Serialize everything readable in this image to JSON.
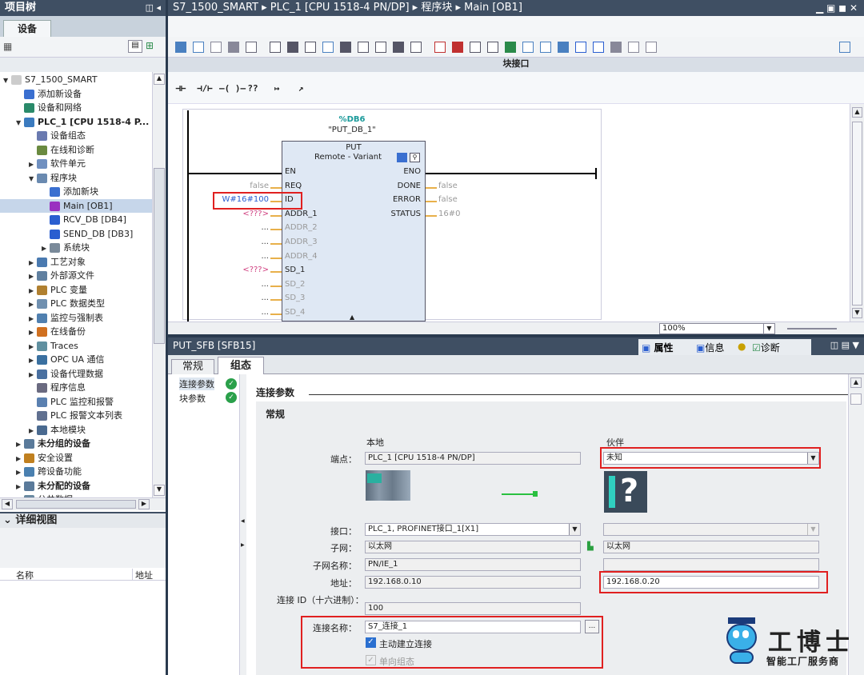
{
  "left_header": {
    "title": "项目树"
  },
  "left_tab": "设备",
  "tree": [
    {
      "label": "S7_1500_SMART",
      "indent": 0,
      "tw": "▼",
      "icon": "project-icon",
      "color": "#ccc"
    },
    {
      "label": "添加新设备",
      "indent": 1,
      "tw": "",
      "icon": "add-device-icon",
      "color": "#3a6fd0"
    },
    {
      "label": "设备和网络",
      "indent": 1,
      "tw": "",
      "icon": "network-icon",
      "color": "#2a8a6a"
    },
    {
      "label": "PLC_1 [CPU 1518-4 P...",
      "indent": 1,
      "tw": "▼",
      "icon": "plc-icon",
      "color": "#3b7bbf",
      "bold": true
    },
    {
      "label": "设备组态",
      "indent": 2,
      "tw": "",
      "icon": "device-config-icon",
      "color": "#6a7ab0"
    },
    {
      "label": "在线和诊断",
      "indent": 2,
      "tw": "",
      "icon": "online-diagnostics-icon",
      "color": "#6a8a40"
    },
    {
      "label": "软件单元",
      "indent": 2,
      "tw": "▶",
      "icon": "software-unit-icon",
      "color": "#7090c0"
    },
    {
      "label": "程序块",
      "indent": 2,
      "tw": "▼",
      "icon": "program-blocks-icon",
      "color": "#6a8ab0"
    },
    {
      "label": "添加新块",
      "indent": 3,
      "tw": "",
      "icon": "add-block-icon",
      "color": "#3a6fd0"
    },
    {
      "label": "Main [OB1]",
      "indent": 3,
      "tw": "",
      "icon": "ob-icon",
      "color": "#9a30c0",
      "selected": true
    },
    {
      "label": "RCV_DB [DB4]",
      "indent": 3,
      "tw": "",
      "icon": "db-icon",
      "color": "#2a5ed0"
    },
    {
      "label": "SEND_DB [DB3]",
      "indent": 3,
      "tw": "",
      "icon": "db-icon",
      "color": "#2a5ed0"
    },
    {
      "label": "系统块",
      "indent": 3,
      "tw": "▶",
      "icon": "system-blocks-icon",
      "color": "#7a8a9a"
    },
    {
      "label": "工艺对象",
      "indent": 2,
      "tw": "▶",
      "icon": "technology-objects-icon",
      "color": "#4a7ab0"
    },
    {
      "label": "外部源文件",
      "indent": 2,
      "tw": "▶",
      "icon": "external-source-icon",
      "color": "#6080a0"
    },
    {
      "label": "PLC 变量",
      "indent": 2,
      "tw": "▶",
      "icon": "plc-tags-icon",
      "color": "#b08030"
    },
    {
      "label": "PLC 数据类型",
      "indent": 2,
      "tw": "▶",
      "icon": "plc-datatype-icon",
      "color": "#7090b0"
    },
    {
      "label": "监控与强制表",
      "indent": 2,
      "tw": "▶",
      "icon": "watch-table-icon",
      "color": "#5080b0"
    },
    {
      "label": "在线备份",
      "indent": 2,
      "tw": "▶",
      "icon": "online-backup-icon",
      "color": "#d07020"
    },
    {
      "label": "Traces",
      "indent": 2,
      "tw": "▶",
      "icon": "traces-icon",
      "color": "#6090a0"
    },
    {
      "label": "OPC UA 通信",
      "indent": 2,
      "tw": "▶",
      "icon": "opcua-icon",
      "color": "#3a70a0"
    },
    {
      "label": "设备代理数据",
      "indent": 2,
      "tw": "▶",
      "icon": "device-proxy-icon",
      "color": "#4a70a0"
    },
    {
      "label": "程序信息",
      "indent": 2,
      "tw": "",
      "icon": "program-info-icon",
      "color": "#6a6a80"
    },
    {
      "label": "PLC 监控和报警",
      "indent": 2,
      "tw": "",
      "icon": "plc-alarms-icon",
      "color": "#5a80b0"
    },
    {
      "label": "PLC 报警文本列表",
      "indent": 2,
      "tw": "",
      "icon": "alarm-text-icon",
      "color": "#607090"
    },
    {
      "label": "本地模块",
      "indent": 2,
      "tw": "▶",
      "icon": "local-modules-icon",
      "color": "#4a6a90"
    },
    {
      "label": "未分组的设备",
      "indent": 1,
      "tw": "▶",
      "icon": "ungrouped-devices-icon",
      "color": "#5a7a9a",
      "bold": true
    },
    {
      "label": "安全设置",
      "indent": 1,
      "tw": "▶",
      "icon": "security-icon",
      "color": "#c08020"
    },
    {
      "label": "跨设备功能",
      "indent": 1,
      "tw": "▶",
      "icon": "cross-device-icon",
      "color": "#4a80b0"
    },
    {
      "label": "未分配的设备",
      "indent": 1,
      "tw": "▶",
      "icon": "unassigned-devices-icon",
      "color": "#5a7a9a",
      "bold": true
    },
    {
      "label": "公共数据",
      "indent": 1,
      "tw": "▶",
      "icon": "common-data-icon",
      "color": "#6a8aa0"
    }
  ],
  "detail_view": {
    "title": "详细视图",
    "col_name": "名称",
    "col_addr": "地址"
  },
  "breadcrumb": [
    "S7_1500_SMART",
    "PLC_1 [CPU 1518-4 PN/DP]",
    "程序块",
    "Main [OB1]"
  ],
  "block_interface_label": "块接口",
  "lad_buttons": [
    "⊣⊢",
    "⊣/⊢",
    "–( )–",
    "??",
    "↦",
    "↗"
  ],
  "fb": {
    "db_name": "%DB6",
    "db_symbol": "\"PUT_DB_1\"",
    "title": "PUT",
    "subtitle": "Remote - Variant",
    "in_pins": [
      "EN",
      "REQ",
      "ID",
      "ADDR_1",
      "ADDR_2",
      "ADDR_3",
      "ADDR_4",
      "SD_1",
      "SD_2",
      "SD_3",
      "SD_4"
    ],
    "out_pins": [
      "ENO",
      "DONE",
      "ERROR",
      "STATUS"
    ],
    "in_values": [
      "",
      "false",
      "W#16#100",
      "<???>",
      "...",
      "...",
      "...",
      "<???>",
      "...",
      "...",
      "..."
    ],
    "out_values": [
      "",
      "false",
      "false",
      "16#0"
    ]
  },
  "zoom": "100%",
  "props": {
    "block_title": "PUT_SFB [SFB15]",
    "tabs_right": [
      "属性",
      "信息",
      "诊断"
    ],
    "tabs": [
      "常规",
      "组态"
    ],
    "nav": [
      "连接参数",
      "块参数"
    ],
    "section": "连接参数",
    "subsection": "常规",
    "col_local": "本地",
    "col_partner": "伙伴",
    "endpoint_label": "端点：",
    "endpoint_local": "PLC_1 [CPU 1518-4 PN/DP]",
    "endpoint_partner": "未知",
    "interface_label": "接口：",
    "interface_local": "PLC_1, PROFINET接口_1[X1]",
    "subnet_label": "子网：",
    "subnet_local": "以太网",
    "subnet_partner": "以太网",
    "subnet_name_label": "子网名称：",
    "subnet_name_local": "PN/IE_1",
    "address_label": "地址：",
    "address_local": "192.168.0.10",
    "address_partner": "192.168.0.20",
    "conn_id_label": "连接 ID（十六进制）：",
    "conn_id": "100",
    "conn_name_label": "连接名称：",
    "conn_name": "S7_连接_1",
    "active_conn": "主动建立连接",
    "oneway": "单向组态"
  },
  "brand": {
    "name": "工博士",
    "tagline": "智能工厂服务商"
  }
}
